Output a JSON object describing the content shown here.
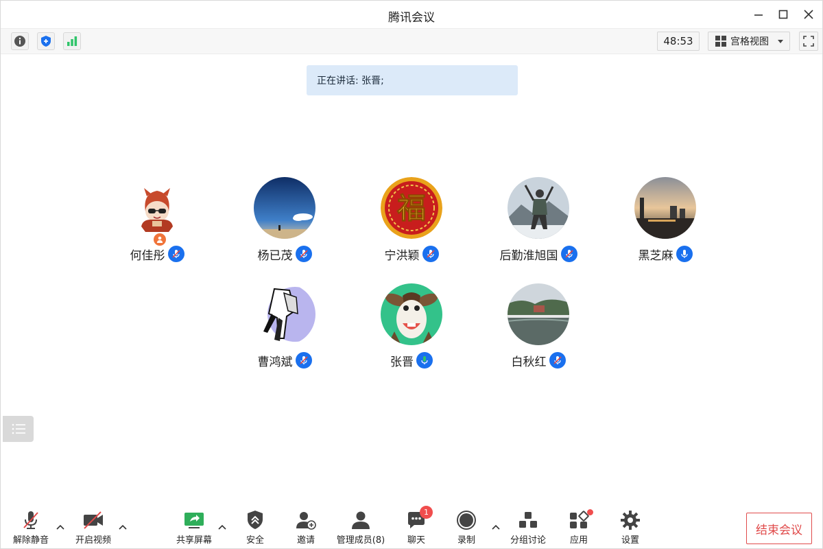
{
  "window": {
    "title": "腾讯会议"
  },
  "infobar": {
    "timer": "48:53",
    "view_label": "宫格视图"
  },
  "speaking": {
    "text": "正在讲话: 张晋;"
  },
  "participants": [
    {
      "name": "何佳彤",
      "mic": "muted",
      "role": "host"
    },
    {
      "name": "杨已茂",
      "mic": "muted"
    },
    {
      "name": "宁洪颖",
      "mic": "muted"
    },
    {
      "name": "后勤淮旭国",
      "mic": "muted"
    },
    {
      "name": "黑芝麻",
      "mic": "on"
    },
    {
      "name": "曹鸿斌",
      "mic": "muted"
    },
    {
      "name": "张晋",
      "mic": "speaking"
    },
    {
      "name": "白秋红",
      "mic": "muted"
    }
  ],
  "toolbar": {
    "unmute": "解除静音",
    "video": "开启视频",
    "share": "共享屏幕",
    "security": "安全",
    "invite": "邀请",
    "members": "管理成员(8)",
    "chat": "聊天",
    "chat_badge": "1",
    "record": "录制",
    "breakout": "分组讨论",
    "apps": "应用",
    "settings": "设置",
    "end": "结束会议"
  },
  "colors": {
    "accent": "#1a70ee",
    "end": "#e04a4a",
    "speaking_bg": "#dceaf9",
    "mic_active": "#2fc46a"
  }
}
